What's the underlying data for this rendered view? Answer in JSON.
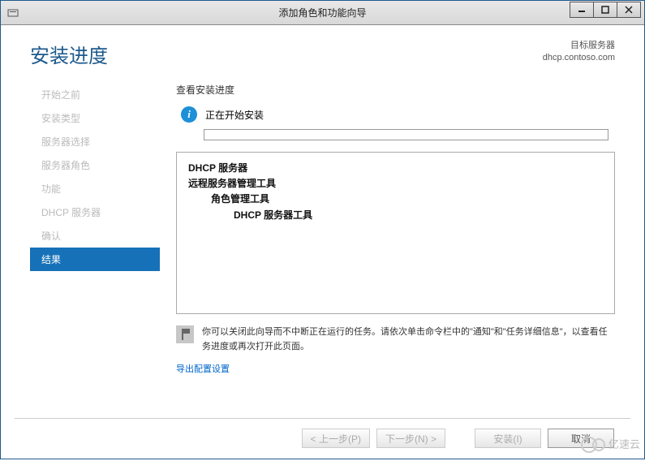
{
  "window": {
    "title": "添加角色和功能向导",
    "minimize": "—",
    "maximize": "□",
    "close": "×"
  },
  "header": {
    "page_title": "安装进度",
    "target_label": "目标服务器",
    "target_value": "dhcp.contoso.com"
  },
  "sidebar": {
    "items": [
      {
        "label": "开始之前"
      },
      {
        "label": "安装类型"
      },
      {
        "label": "服务器选择"
      },
      {
        "label": "服务器角色"
      },
      {
        "label": "功能"
      },
      {
        "label": "DHCP 服务器"
      },
      {
        "label": "确认"
      },
      {
        "label": "结果"
      }
    ]
  },
  "panel": {
    "section_label": "查看安装进度",
    "status_text": "正在开始安装",
    "install_items": {
      "l0": "DHCP 服务器",
      "l1": "远程服务器管理工具",
      "l2": "角色管理工具",
      "l3": "DHCP 服务器工具"
    },
    "note_text": "你可以关闭此向导而不中断正在运行的任务。请依次单击命令栏中的\"通知\"和\"任务详细信息\"，以查看任务进度或再次打开此页面。",
    "export_link": "导出配置设置"
  },
  "buttons": {
    "prev": "< 上一步(P)",
    "next": "下一步(N) >",
    "install": "安装(I)",
    "cancel": "取消"
  },
  "watermark": "亿速云"
}
